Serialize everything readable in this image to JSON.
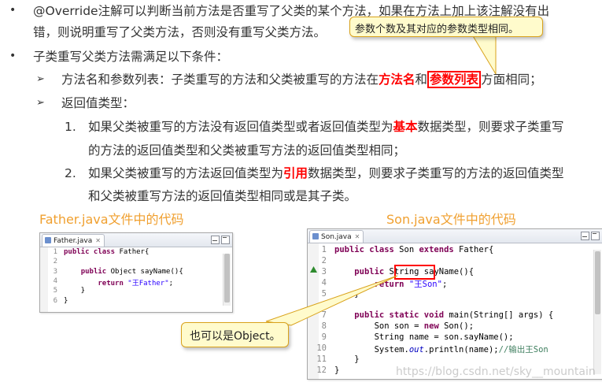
{
  "doc": {
    "bullet1": {
      "line1": "@Override注解可以判断当前方法是否重写了父类的某个方法，如果在方法上加上该注解没有出",
      "line2": "错，则说明重写了父类方法，否则没有重写父类方法。"
    },
    "callout_top": "参数个数及其对应的参数类型相同。",
    "bullet2": "子类重写父类方法需满足以下条件：",
    "sub1": {
      "prefix": "方法名和参数列表：子类重写的方法和父类被重写的方法在",
      "bold1": "方法名",
      "mid": "和",
      "bold2": "参数列表",
      "suffix": "方面相同；"
    },
    "sub2": "返回值类型：",
    "item1": {
      "num": "1.",
      "prefix": "如果父类被重写的方法没有返回值类型或者返回值类型为",
      "bold": "基本",
      "suffix": "数据类型，则要求子类重写",
      "line2": "的方法的返回值类型和父类被重写方法的返回值类型相同；"
    },
    "item2": {
      "num": "2.",
      "prefix": "如果父类被重写的方法返回值类型为",
      "bold": "引用",
      "suffix": "数据类型，则要求子类重写的方法的返回值类型",
      "line2": "和父类被重写方法的返回值类型相同或是其子类。"
    },
    "caption_father": "Father.java文件中的代码",
    "caption_son": "Son.java文件中的代码",
    "callout_bottom": "也可以是Object。",
    "watermark": "https://blog.csdn.net/sky__mountain"
  },
  "father_editor": {
    "tab": "Father.java",
    "lines": [
      {
        "n": "1",
        "html": "<span class='kw'>public class</span> Father{"
      },
      {
        "n": "2",
        "html": ""
      },
      {
        "n": "3",
        "html": "    <span class='kw'>public</span> Object sayName(){"
      },
      {
        "n": "4",
        "html": "        <span class='kw'>return</span> <span class='str'>\"王Father\"</span>;"
      },
      {
        "n": "5",
        "html": "    }"
      },
      {
        "n": "6",
        "html": "}"
      }
    ]
  },
  "son_editor": {
    "tab": "Son.java",
    "lines": [
      {
        "n": "1",
        "html": "<span class='kw'>public class</span> Son <span class='kw'>extends</span> Father{"
      },
      {
        "n": "2",
        "html": ""
      },
      {
        "n": "3",
        "html": "    <span class='kw'>public</span> String sayName(){"
      },
      {
        "n": "4",
        "html": "        <span class='kw'>return</span> <span class='str'>\"王Son\"</span>;"
      },
      {
        "n": "5",
        "html": "    }"
      },
      {
        "n": "6",
        "html": ""
      },
      {
        "n": "7",
        "html": "    <span class='kw'>public static void</span> main(String[] args) {"
      },
      {
        "n": "8",
        "html": "        Son son = <span class='kw'>new</span> Son();"
      },
      {
        "n": "9",
        "html": "        String name = son.sayName();"
      },
      {
        "n": "10",
        "html": "        System.<span class='fld'>out</span>.println(name);<span class='cmt'>//输出王Son</span>"
      },
      {
        "n": "11",
        "html": "    }"
      },
      {
        "n": "12",
        "html": "}"
      }
    ]
  }
}
